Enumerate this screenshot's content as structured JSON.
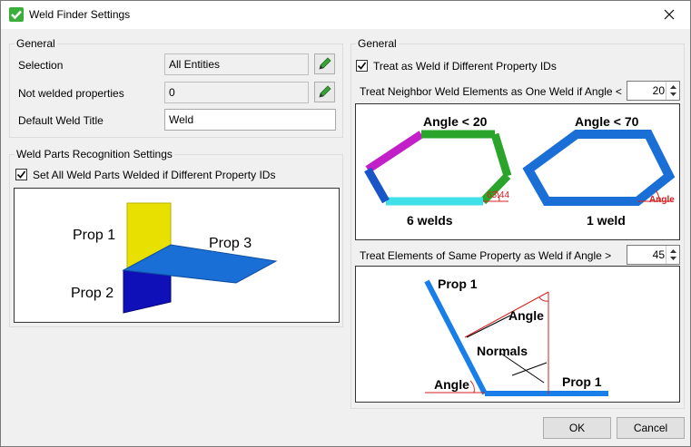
{
  "window": {
    "title": "Weld Finder Settings"
  },
  "left": {
    "general_label": "General",
    "rows": [
      {
        "label": "Selection",
        "value": "All Entities"
      },
      {
        "label": "Not welded properties",
        "value": "0"
      },
      {
        "label": "Default Weld Title",
        "value": "Weld"
      }
    ],
    "parts_group_label": "Weld Parts Recognition Settings",
    "parts_checkbox_label": "Set All Weld Parts Welded if Different Property IDs",
    "figure_labels": {
      "prop1": "Prop 1",
      "prop2": "Prop 2",
      "prop3": "Prop 3"
    }
  },
  "right": {
    "general_label": "General",
    "treat_checkbox_label": "Treat as Weld if Different Property IDs",
    "neighbor_label": "Treat Neighbor Weld Elements as One Weld if Angle <",
    "neighbor_value": "20",
    "hex_figure": {
      "left_title": "Angle < 20",
      "right_title": "Angle < 70",
      "left_angle": "63.44",
      "right_angle": "Angle",
      "left_caption": "6 welds",
      "right_caption": "1 weld"
    },
    "same_property_label": "Treat Elements of Same Property as Weld if Angle >",
    "same_property_value": "45",
    "normals_figure": {
      "prop_top": "Prop 1",
      "prop_bottom": "Prop 1",
      "angle_top": "Angle",
      "angle_bottom": "Angle",
      "normals": "Normals"
    }
  },
  "footer": {
    "ok_label": "OK",
    "cancel_label": "Cancel"
  },
  "colors": {
    "accent_green": "#3cae3c",
    "weld_blue": "#1a6fd6"
  }
}
